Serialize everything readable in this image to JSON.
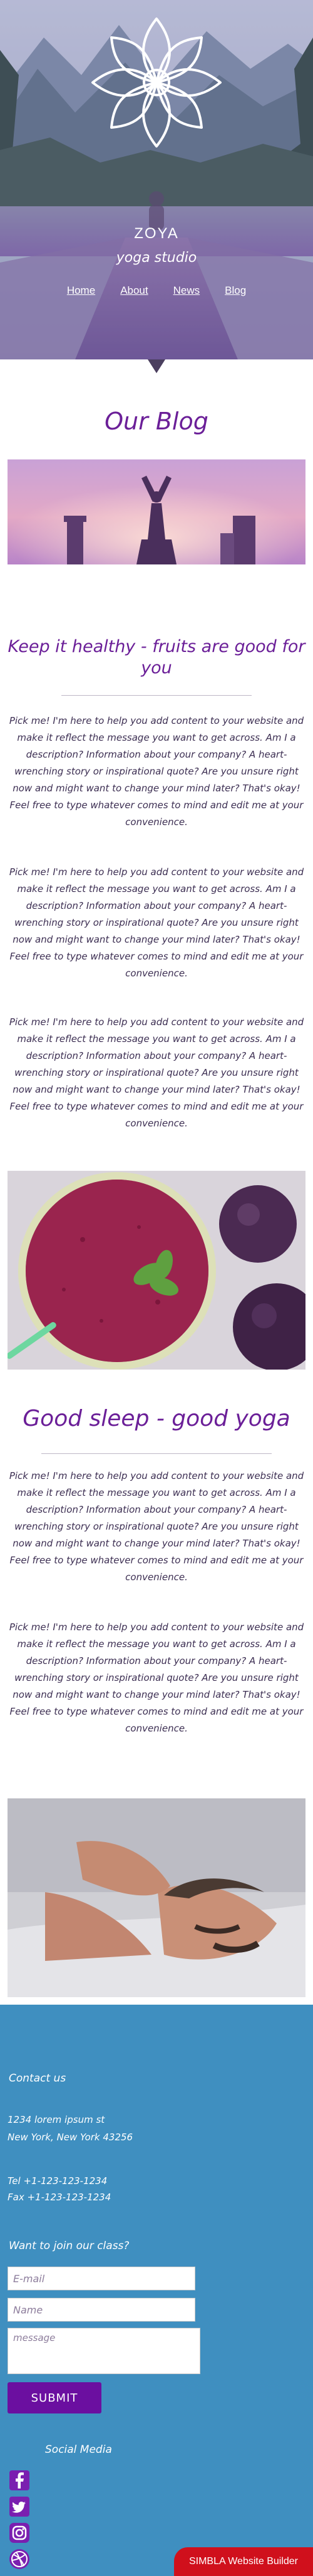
{
  "header": {
    "brand_name": "ZOYA",
    "brand_tagline": "yoga studio",
    "nav": [
      "Home",
      "About",
      "News",
      "Blog"
    ]
  },
  "blog": {
    "heading": "Our Blog",
    "posts": [
      {
        "title": "Keep it healthy - fruits are good for you",
        "paragraphs": [
          "Pick me! I'm here to help you add content to your website and make it reflect the message you want to get across. Am I a description? Information about your company? A heart-wrenching story or inspirational quote? Are you unsure right now and might want to change your mind later? That's okay! Feel free to type whatever comes to mind and edit me at your convenience.",
          "Pick me! I'm here to help you add content to your website and make it reflect the message you want to get across. Am I a description? Information about your company? A heart-wrenching story or inspirational quote? Are you unsure right now and might want to change your mind later? That's okay! Feel free to type whatever comes to mind and edit me at your convenience.",
          "Pick me! I'm here to help you add content to your website and make it reflect the message you want to get across. Am I a description? Information about your company? A heart-wrenching story or inspirational quote? Are you unsure right now and might want to change your mind later? That's okay! Feel free to type whatever comes to mind and edit me at your convenience."
        ]
      },
      {
        "title": "Good sleep - good yoga",
        "paragraphs": [
          "Pick me! I'm here to help you add content to your website and make it reflect the message you want to get across. Am I a description? Information about your company? A heart-wrenching story or inspirational quote? Are you unsure right now and might want to change your mind later? That's okay! Feel free to type whatever comes to mind and edit me at your convenience.",
          "Pick me! I'm here to help you add content to your website and make it reflect the message you want to get across. Am I a description? Information about your company? A heart-wrenching story or inspirational quote? Are you unsure right now and might want to change your mind later? That's okay! Feel free to type whatever comes to mind and edit me at your convenience."
        ]
      }
    ]
  },
  "footer": {
    "contact_heading": "Contact us",
    "address_line1": "1234 lorem ipsum st",
    "address_line2": "New York, New York 43256",
    "tel": "Tel +1-123-123-1234",
    "fax": "Fax +1-123-123-1234",
    "join_heading": "Want to join our class?",
    "email_placeholder": "E-mail",
    "name_placeholder": "Name",
    "message_placeholder": "message",
    "submit_label": "SUBMIT",
    "social_heading": "Social Media",
    "social_icons": [
      "facebook-icon",
      "twitter-icon",
      "instagram-icon",
      "dribbble-icon"
    ],
    "builder_badge": "SIMBLA Website Builder"
  },
  "colors": {
    "accent_purple": "#6b1f98",
    "footer_blue": "#3f8fc0",
    "submit_purple": "#6b0fa0",
    "badge_red": "#d0101c"
  }
}
